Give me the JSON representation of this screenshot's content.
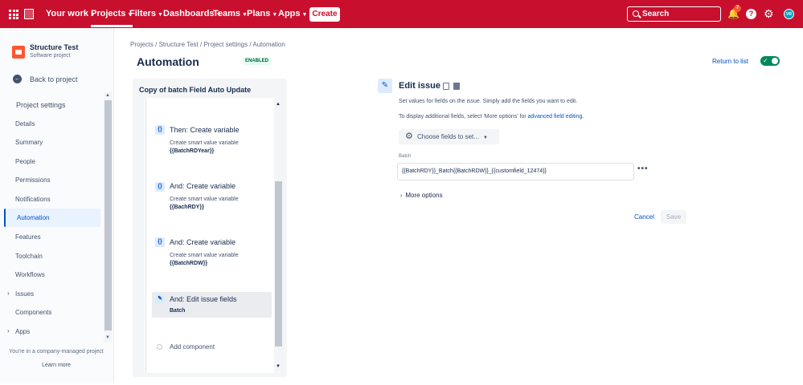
{
  "topbar": {
    "nav": [
      {
        "label": "Your work",
        "chevron": true
      },
      {
        "label": "Projects",
        "chevron": true
      },
      {
        "label": "Filters",
        "chevron": true
      },
      {
        "label": "Dashboards",
        "chevron": true
      },
      {
        "label": "Teams",
        "chevron": true
      },
      {
        "label": "Plans",
        "chevron": true
      },
      {
        "label": "Apps",
        "chevron": true
      }
    ],
    "create_label": "Create",
    "search_placeholder": "Search",
    "notification_count": "7",
    "help_icon": "help-icon",
    "settings_icon": "gear-icon",
    "avatar_initials": "VR",
    "brand_color": "#c8102e"
  },
  "sidebar": {
    "project_name": "Structure Test",
    "project_type": "Software project",
    "back_label": "Back to project",
    "section_heading": "Project settings",
    "items": [
      {
        "label": "Details"
      },
      {
        "label": "Summary"
      },
      {
        "label": "People"
      },
      {
        "label": "Permissions"
      },
      {
        "label": "Notifications"
      },
      {
        "label": "Automation"
      },
      {
        "label": "Features"
      },
      {
        "label": "Toolchain"
      },
      {
        "label": "Workflows"
      },
      {
        "label": "Issues"
      },
      {
        "label": "Components"
      },
      {
        "label": "Apps"
      }
    ],
    "footer_text": "You're in a company-managed project",
    "footer_link": "Learn more"
  },
  "header": {
    "breadcrumbs": "Projects / Structure Test / Project settings / Automation",
    "title": "Automation",
    "status_badge": "ENABLED",
    "return_link": "Return to list",
    "toggle_on": true
  },
  "rule": {
    "title": "Copy of batch Field Auto Update",
    "steps": [
      {
        "title": "Then: Create variable",
        "desc": "Create smart value variable",
        "value": "{{BatchRDYear}}"
      },
      {
        "title": "And: Create variable",
        "desc": "Create smart value variable",
        "value": "{{BachRDY}}"
      },
      {
        "title": "And: Create variable",
        "desc": "Create smart value variable",
        "value": "{{BatchRDW}}"
      },
      {
        "title": "And: Edit issue fields",
        "value": "Batch"
      }
    ],
    "add_component": "Add component"
  },
  "editor": {
    "title": "Edit issue",
    "desc1": "Set values for fields on the issue. Simply add the fields you want to edit.",
    "desc2_prefix": "To display additional fields, select 'More options' for ",
    "desc2_link": "advanced field editing.",
    "choose_label": "Choose fields to set...",
    "field_label": "Batch",
    "field_value": "{{BatchRDY}}_Batch{{BatchRDW}}_{{customfield_12474}}",
    "more_options": "More options",
    "cancel": "Cancel",
    "save": "Save"
  }
}
